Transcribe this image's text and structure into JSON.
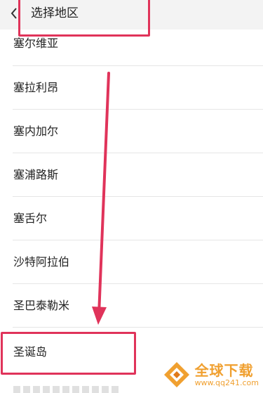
{
  "header": {
    "title": "选择地区",
    "back_icon": "chevron-left-icon"
  },
  "regions": [
    "塞尔维亚",
    "塞拉利昂",
    "塞内加尔",
    "塞浦路斯",
    "塞舌尔",
    "沙特阿拉伯",
    "圣巴泰勒米",
    "圣诞岛"
  ],
  "watermark": {
    "title": "全球下载",
    "url": "www.qq241.com"
  },
  "colors": {
    "highlight": "#e0335a",
    "watermark": "#f0a030",
    "header_bg": "#f3f3f3"
  }
}
